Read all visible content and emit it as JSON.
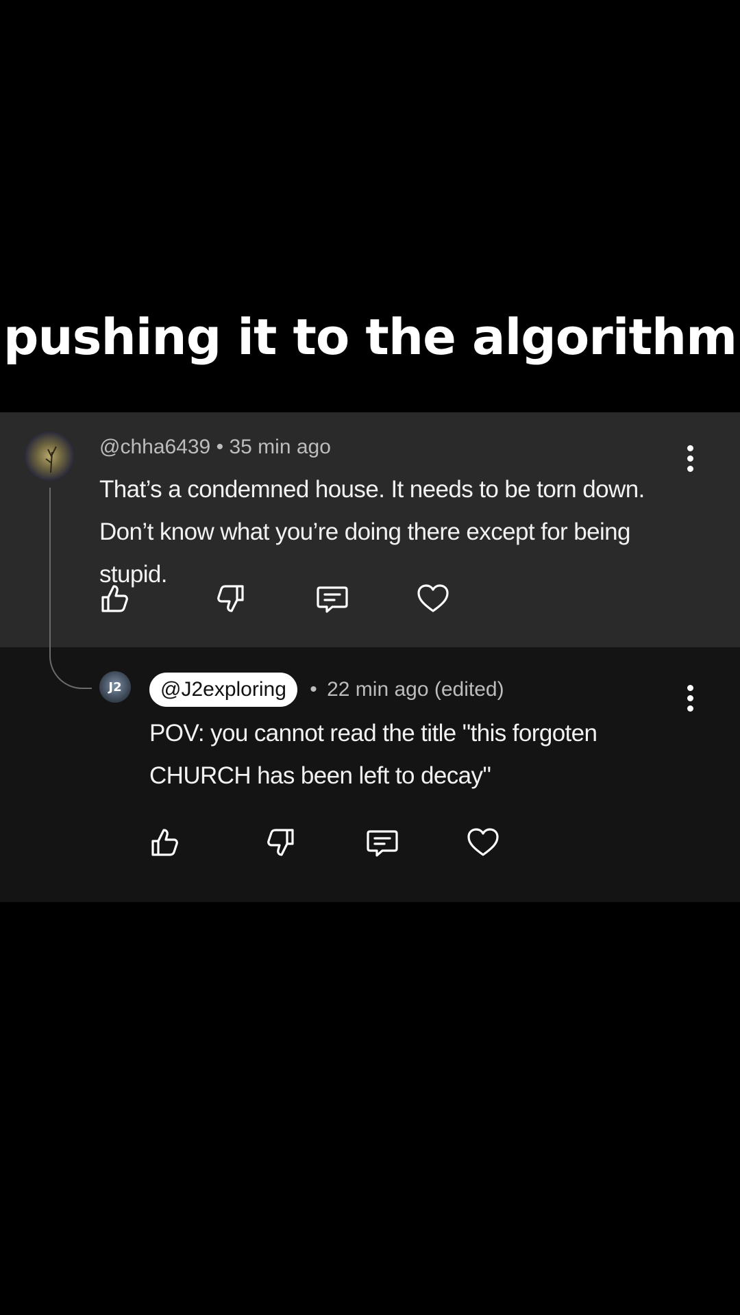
{
  "caption": "pushing it to the algorithm",
  "parent_comment": {
    "handle": "@chha6439",
    "separator": "•",
    "time": "35 min ago",
    "text": "That’s a condemned house. It needs to be torn down. Don’t know what you’re doing there except for being stupid.",
    "avatar_icon": "night-tree-avatar"
  },
  "reply_comment": {
    "handle": "@J2exploring",
    "separator": "•",
    "time": "22 min ago (edited)",
    "text": "POV: you cannot read the title \"this forgoten CHURCH has been left to decay\"",
    "avatar_label": "J2"
  },
  "actions": [
    "thumbs-up-icon",
    "thumbs-down-icon",
    "reply-icon",
    "heart-icon"
  ],
  "colors": {
    "background": "#000000",
    "parent_card": "#2a2a2b",
    "reply_card": "#141414",
    "text": "#ffffff",
    "meta": "#bdbdbd"
  }
}
